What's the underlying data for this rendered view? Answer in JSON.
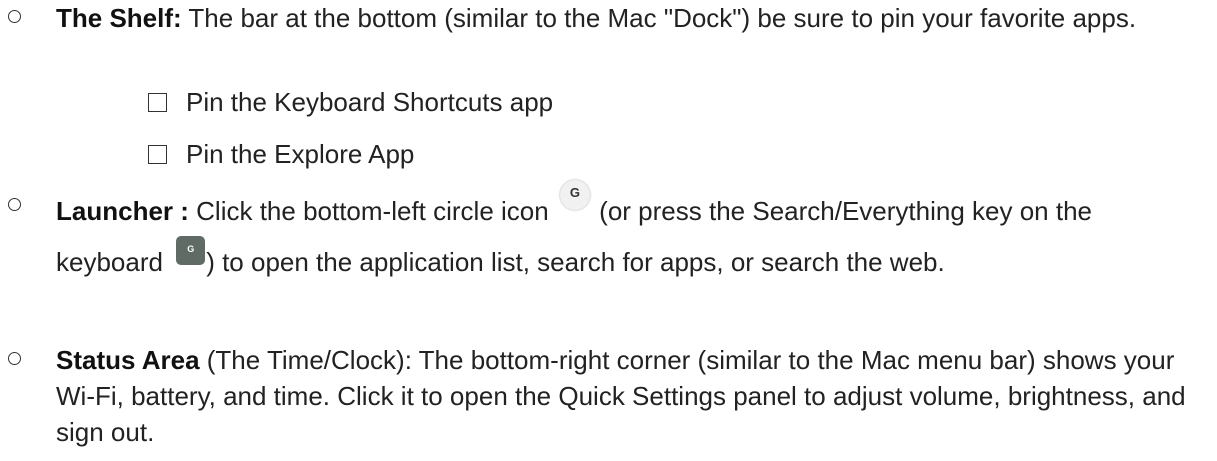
{
  "items": [
    {
      "title": "The Shelf:",
      "text": " The bar at the bottom (similar to the Mac \"Dock\") be sure to pin your favorite apps.",
      "checklist": [
        "Pin the Keyboard Shortcuts app",
        "Pin the Explore App"
      ]
    },
    {
      "title": "Launcher :",
      "text_1": " Click the bottom-left circle icon",
      "launcher_icon_glyph": "G",
      "text_2": " (or press the Search/Everything key on the keyboard",
      "key_icon_glyph": "G",
      "text_3": ") to open the application list, search for apps, or search the web."
    },
    {
      "title": "Status Area",
      "text": " (The Time/Clock): The bottom-right corner (similar to the Mac menu bar) shows your Wi-Fi, battery, and time. Click it to open the Quick Settings panel to adjust volume, brightness, and sign out."
    }
  ],
  "icons": {
    "bullet": "hollow-circle-bullet",
    "checkbox": "empty-checkbox",
    "launcher": "launcher-circle-icon",
    "search_key": "search-everything-key-icon"
  }
}
